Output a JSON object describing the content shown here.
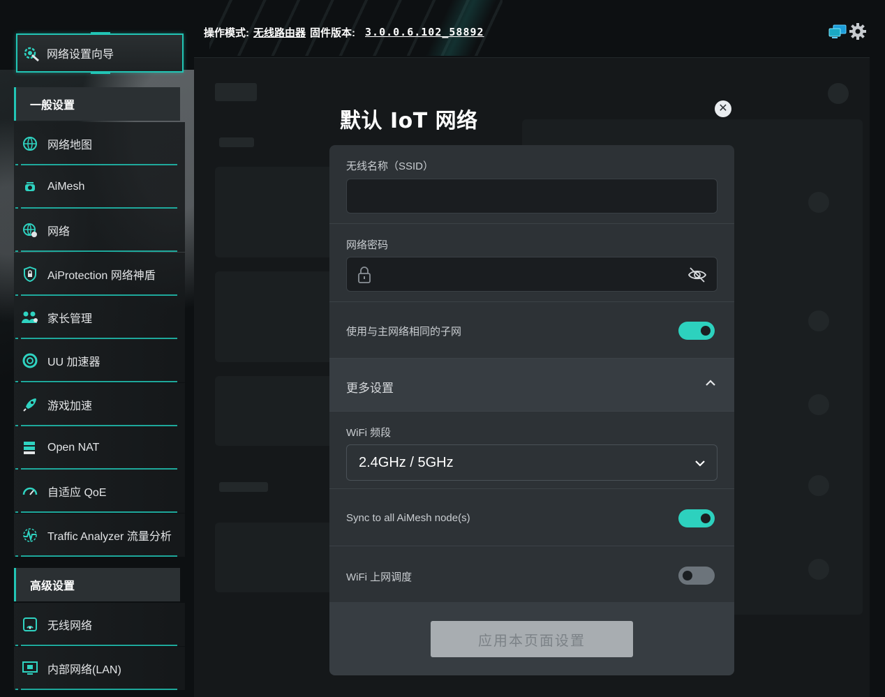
{
  "header": {
    "mode_label": "操作模式:",
    "mode_value": "无线路由器",
    "firmware_label": "固件版本:",
    "firmware_value": "3.0.0.6.102_58892"
  },
  "top_icons": [
    "network-status-icon",
    "gear-icon"
  ],
  "sidebar": {
    "wizard": {
      "label": "网络设置向导",
      "icon": "wizard-icon"
    },
    "general_section": "一般设置",
    "general_items": [
      {
        "label": "网络地图",
        "icon": "globe-map-icon"
      },
      {
        "label": "AiMesh",
        "icon": "aimesh-icon"
      },
      {
        "label": "网络",
        "icon": "network-globe-icon"
      },
      {
        "label": "AiProtection 网络神盾",
        "icon": "shield-lock-icon"
      },
      {
        "label": "家长管理",
        "icon": "family-icon"
      },
      {
        "label": "UU 加速器",
        "icon": "uu-accelerator-icon"
      },
      {
        "label": "游戏加速",
        "icon": "rocket-icon"
      },
      {
        "label": "Open NAT",
        "icon": "server-icon"
      },
      {
        "label": "自适应 QoE",
        "icon": "gauge-icon"
      },
      {
        "label": "Traffic Analyzer 流量分析",
        "icon": "traffic-analyzer-icon"
      }
    ],
    "advanced_section": "高级设置",
    "advanced_items": [
      {
        "label": "无线网络",
        "icon": "wireless-icon"
      },
      {
        "label": "内部网络(LAN)",
        "icon": "lan-monitor-icon"
      }
    ]
  },
  "modal": {
    "title": "默认 IoT 网络",
    "ssid_label": "无线名称（SSID）",
    "ssid_value": "",
    "password_label": "网络密码",
    "password_value": "",
    "same_subnet_label": "使用与主网络相同的子网",
    "same_subnet_on": true,
    "more_settings_label": "更多设置",
    "more_settings_expanded": true,
    "band_label": "WiFi 频段",
    "band_value": "2.4GHz / 5GHz",
    "sync_label": "Sync to all AiMesh node(s)",
    "sync_on": true,
    "schedule_label": "WiFi 上网调度",
    "schedule_on": false,
    "apply_label": "应用本页面设置"
  },
  "colors": {
    "accent": "#22c5b5",
    "toggle_on": "#2dd1be",
    "modal_bg": "#2d3236",
    "page_bg": "#0d1012"
  }
}
